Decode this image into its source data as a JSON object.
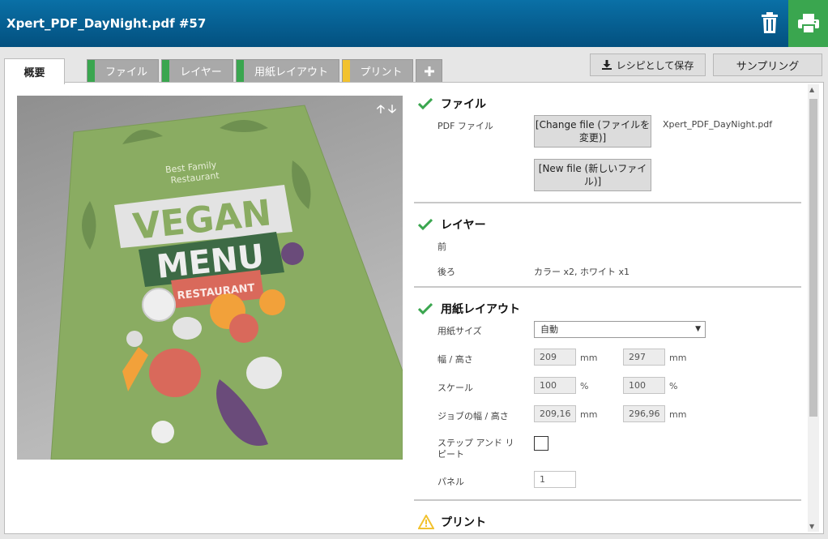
{
  "window": {
    "title": "Xpert_PDF_DayNight.pdf #57"
  },
  "tabs": [
    {
      "label": "概要",
      "stripe": ""
    },
    {
      "label": "ファイル",
      "stripe": "#3aa64f"
    },
    {
      "label": "レイヤー",
      "stripe": "#3aa64f"
    },
    {
      "label": "用紙レイアウト",
      "stripe": "#3aa64f"
    },
    {
      "label": "プリント",
      "stripe": "#f2c22e"
    }
  ],
  "add_tab_icon": "plus-icon",
  "top_buttons": {
    "save_recipe": "レシピとして保存",
    "sampling": "サンプリング"
  },
  "preview": {
    "poster_subtitle": "Best Family Restaurant",
    "poster_title_1": "VEGAN",
    "poster_title_2": "MENU",
    "poster_badge": "RESTAURANT"
  },
  "file_section": {
    "title": "ファイル",
    "status": "ok",
    "pdf_label": "PDF ファイル",
    "filename": "Xpert_PDF_DayNight.pdf",
    "change_button": "[Change file (ファイルを変更)]",
    "new_button": "[New file (新しいファイル)]"
  },
  "layer_section": {
    "title": "レイヤー",
    "status": "ok",
    "front_label": "前",
    "back_label": "後ろ",
    "back_value": "カラー x2, ホワイト x1"
  },
  "paper_section": {
    "title": "用紙レイアウト",
    "status": "ok",
    "paper_size_label": "用紙サイズ",
    "paper_size_value": "自動",
    "wh_label": "幅 / 高さ",
    "width": "209",
    "height": "297",
    "unit_mm": "mm",
    "scale_label": "スケール",
    "scale_x": "100",
    "scale_y": "100",
    "unit_pct": "%",
    "job_wh_label": "ジョブの幅 / 高さ",
    "job_width": "209,16",
    "job_height": "296,96",
    "step_repeat_label": "ステップ アンド リピート",
    "step_repeat_checked": false,
    "panel_label": "パネル",
    "panel_value": "1"
  },
  "print_section": {
    "title": "プリント",
    "status": "warning"
  },
  "colors": {
    "header": "#03507f",
    "ok_green": "#3aa64f",
    "warning_yellow": "#f2c22e"
  }
}
